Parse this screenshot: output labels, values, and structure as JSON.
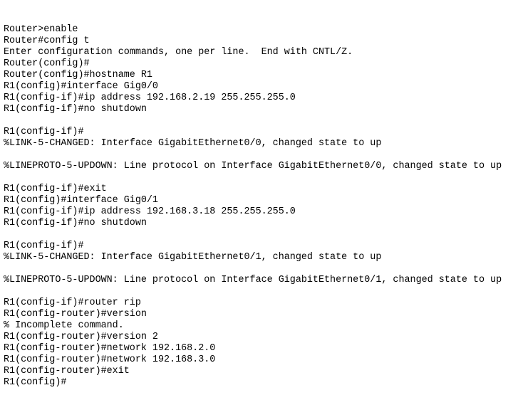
{
  "terminal": {
    "title": "Router CLI",
    "background_color": "#ffffff",
    "text_color": "#000000",
    "prompt_hostname_initial": "Router",
    "prompt_hostname_final": "R1",
    "lines": [
      "Router>enable",
      "Router#config t",
      "Enter configuration commands, one per line.  End with CNTL/Z.",
      "Router(config)#",
      "Router(config)#hostname R1",
      "R1(config)#interface Gig0/0",
      "R1(config-if)#ip address 192.168.2.19 255.255.255.0",
      "R1(config-if)#no shutdown",
      "",
      "R1(config-if)#",
      "%LINK-5-CHANGED: Interface GigabitEthernet0/0, changed state to up",
      "",
      "%LINEPROTO-5-UPDOWN: Line protocol on Interface GigabitEthernet0/0, changed state to up",
      "",
      "R1(config-if)#exit",
      "R1(config)#interface Gig0/1",
      "R1(config-if)#ip address 192.168.3.18 255.255.255.0",
      "R1(config-if)#no shutdown",
      "",
      "R1(config-if)#",
      "%LINK-5-CHANGED: Interface GigabitEthernet0/1, changed state to up",
      "",
      "%LINEPROTO-5-UPDOWN: Line protocol on Interface GigabitEthernet0/1, changed state to up",
      "",
      "R1(config-if)#router rip",
      "R1(config-router)#version",
      "% Incomplete command.",
      "R1(config-router)#version 2",
      "R1(config-router)#network 192.168.2.0",
      "R1(config-router)#network 192.168.3.0",
      "R1(config-router)#exit",
      "R1(config)#"
    ]
  }
}
